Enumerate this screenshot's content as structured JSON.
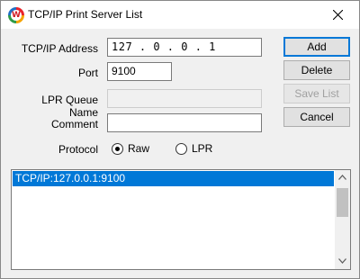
{
  "window": {
    "title": "TCP/IP Print Server List",
    "app_icon_letter": "W"
  },
  "form": {
    "ip_label": "TCP/IP Address",
    "ip_value": "127 .  0 .  0 .  1",
    "port_label": "Port",
    "port_value": "9100",
    "lpr_label": "LPR Queue Name",
    "lpr_value": "",
    "comment_label": "Comment",
    "comment_value": "",
    "protocol_label": "Protocol",
    "protocol_options": [
      {
        "label": "Raw",
        "selected": true
      },
      {
        "label": "LPR",
        "selected": false
      }
    ]
  },
  "buttons": {
    "add": "Add",
    "delete": "Delete",
    "save_list": "Save List",
    "cancel": "Cancel"
  },
  "list": {
    "items": [
      "TCP/IP:127.0.0.1:9100"
    ]
  },
  "colors": {
    "selection": "#0078d7",
    "default_button_border": "#0078d7"
  }
}
